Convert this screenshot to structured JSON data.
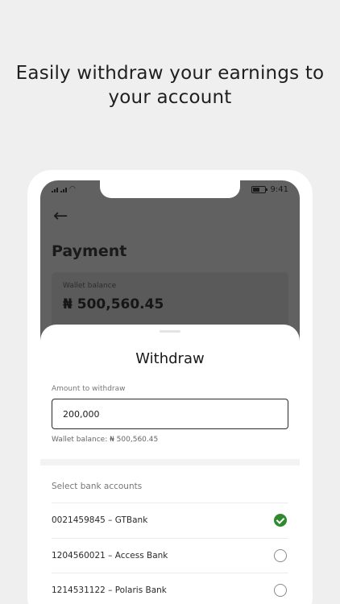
{
  "headline": "Easily withdraw your earnings to your account",
  "status_bar": {
    "time": "9:41"
  },
  "page": {
    "back_icon": "back-arrow-icon",
    "title": "Payment",
    "wallet": {
      "label": "Wallet balance",
      "amount": "₦ 500,560.45"
    }
  },
  "sheet": {
    "title": "Withdraw",
    "amount_label": "Amount to withdraw",
    "amount_value": "200,000",
    "balance_note": "Wallet balance: ₦ 500,560.45",
    "bank_label": "Select bank accounts",
    "banks": [
      {
        "label": "0021459845 – GTBank",
        "selected": true
      },
      {
        "label": "1204560021 – Access Bank",
        "selected": false
      },
      {
        "label": "1214531122 – Polaris Bank",
        "selected": false
      }
    ]
  },
  "colors": {
    "accent": "#2f8a2f",
    "overlay": "#616161",
    "background": "#efefef"
  }
}
